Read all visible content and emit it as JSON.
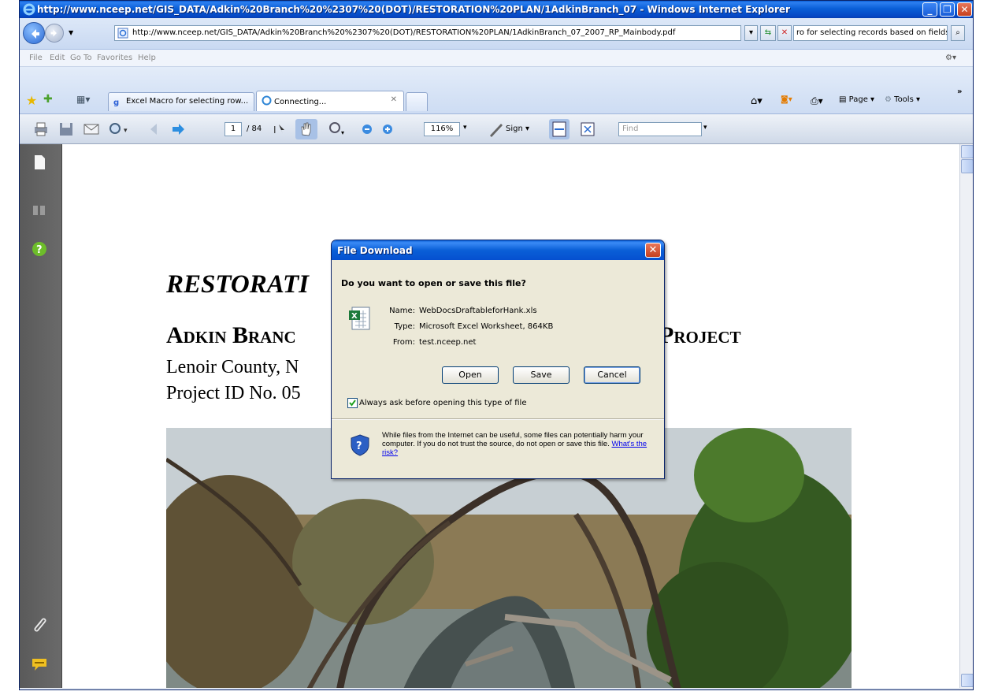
{
  "window": {
    "title": "http://www.nceep.net/GIS_DATA/Adkin%20Branch%20%2307%20(DOT)/RESTORATION%20PLAN/1AdkinBranch_07 - Windows Internet Explorer"
  },
  "address_bar": {
    "url": "http://www.nceep.net/GIS_DATA/Adkin%20Branch%20%2307%20(DOT)/RESTORATION%20PLAN/1AdkinBranch_07_2007_RP_Mainbody.pdf",
    "search_value": "ro for selecting records based on fields"
  },
  "menu": {
    "items": [
      "File",
      "Edit",
      "Go To",
      "Favorites",
      "Help"
    ]
  },
  "tabs": [
    {
      "label": "Excel Macro for selecting row..."
    },
    {
      "label": "Connecting..."
    }
  ],
  "command_bar": {
    "page_label": "Page",
    "tools_label": "Tools"
  },
  "pdf_toolbar": {
    "current_page": "1",
    "total_pages": "/ 84",
    "zoom": "116%",
    "sign_label": "Sign",
    "find_placeholder": "Find"
  },
  "document": {
    "title_line": "RESTORATI",
    "heading_left": "Adkin Branc",
    "heading_right": "Project",
    "line3": "Lenoir County, N",
    "line4": "Project ID No. 05"
  },
  "dialog": {
    "title": "File Download",
    "question": "Do you want to open or save this file?",
    "name_label": "Name:",
    "name_value": "WebDocsDraftableforHank.xls",
    "type_label": "Type:",
    "type_value": "Microsoft Excel Worksheet, 864KB",
    "from_label": "From:",
    "from_value": "test.nceep.net",
    "open_button": "Open",
    "save_button": "Save",
    "cancel_button": "Cancel",
    "always_ask_label": "Always ask before opening this type of file",
    "always_ask_checked": true,
    "warning_text": "While files from the Internet can be useful, some files can potentially harm your computer. If you do not trust the source, do not open or save this file.",
    "risk_link": "What's the risk?"
  },
  "colors": {
    "titlebar_blue": "#0a5fd7",
    "close_red": "#c6401f",
    "dialog_bg": "#ece9d8",
    "acrobat_panel": "#5f5f5f"
  }
}
